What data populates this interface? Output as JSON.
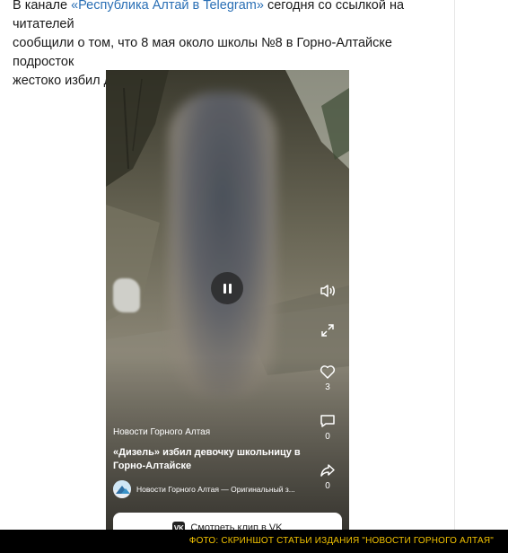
{
  "article": {
    "line1_before": "В канале ",
    "link": "«Республика Алтай в Telegram»",
    "line1_after": " сегодня со ссылкой на читателей",
    "line2": "сообщили о том, что 8 мая около школы №8 в Горно-Алтайске подросток",
    "line3": "жестоко избил девочку."
  },
  "video": {
    "channel_top": "Новости Горного Алтая",
    "title": "«Дизель» избил девочку школьницу в Горно-Алтайске",
    "source_line": "Новости Горного Алтая — Оригинальный з...",
    "likes": "3",
    "comments": "0",
    "shares": "0",
    "watch_label": "Смотреть клип в VK",
    "vk_mark": "VK"
  },
  "caption": "ФОТО: СКРИНШОТ СТАТЬИ ИЗДАНИЯ \"НОВОСТИ ГОРНОГО АЛТАЯ\"",
  "colors": {
    "link": "#2a6fb5",
    "caption_text": "#f4c400",
    "caption_bg": "#000000"
  },
  "icons": [
    "pause-icon",
    "volume-icon",
    "expand-icon",
    "heart-icon",
    "comment-icon",
    "share-icon",
    "vk-icon",
    "channel-logo"
  ]
}
